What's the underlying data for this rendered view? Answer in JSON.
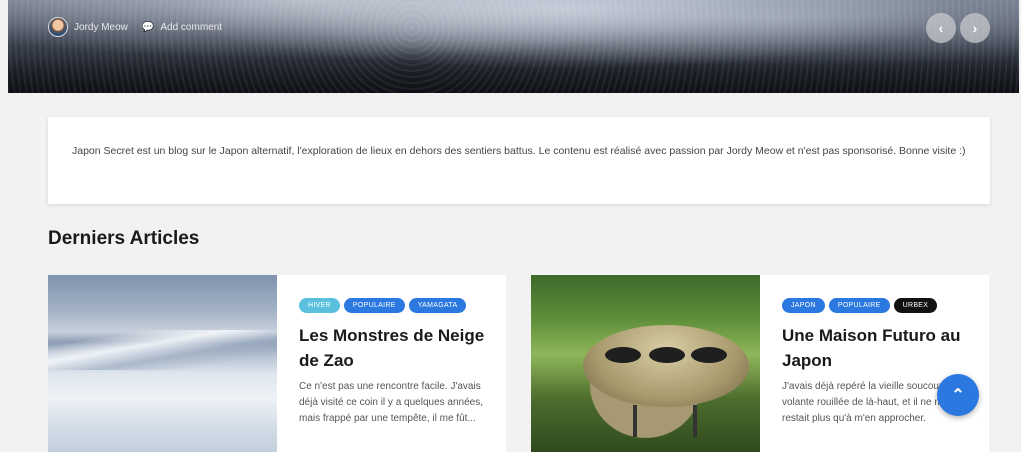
{
  "hero": {
    "author": "Jordy Meow",
    "comment_label": "Add comment",
    "prev_glyph": "‹",
    "next_glyph": "›"
  },
  "intro": {
    "text": "Japon Secret est un blog sur le Japon alternatif, l'exploration de lieux en dehors des sentiers battus. Le contenu est réalisé avec passion par Jordy Meow et n'est pas sponsorisé. Bonne visite :)"
  },
  "section": {
    "title": "Derniers Articles"
  },
  "articles": [
    {
      "tags": [
        {
          "label": "Hiver",
          "color": "#5bc0de"
        },
        {
          "label": "Populaire",
          "color": "#2a78e0"
        },
        {
          "label": "Yamagata",
          "color": "#2a78e0"
        }
      ],
      "title": "Les Monstres de Neige de Zao",
      "excerpt": "Ce n'est pas une rencontre facile. J'avais déjà visité ce coin il y a quelques années, mais frappé par une tempête, il me fût..."
    },
    {
      "tags": [
        {
          "label": "Japon",
          "color": "#2a78e0"
        },
        {
          "label": "Populaire",
          "color": "#2a78e0"
        },
        {
          "label": "Urbex",
          "color": "#111111"
        }
      ],
      "title": "Une Maison Futuro au Japon",
      "excerpt": "J'avais déjà repéré la vieille soucoupe volante rouillée de là-haut, et il ne me restait plus qu'à m'en approcher."
    }
  ],
  "fab": {
    "glyph": "⌃"
  }
}
